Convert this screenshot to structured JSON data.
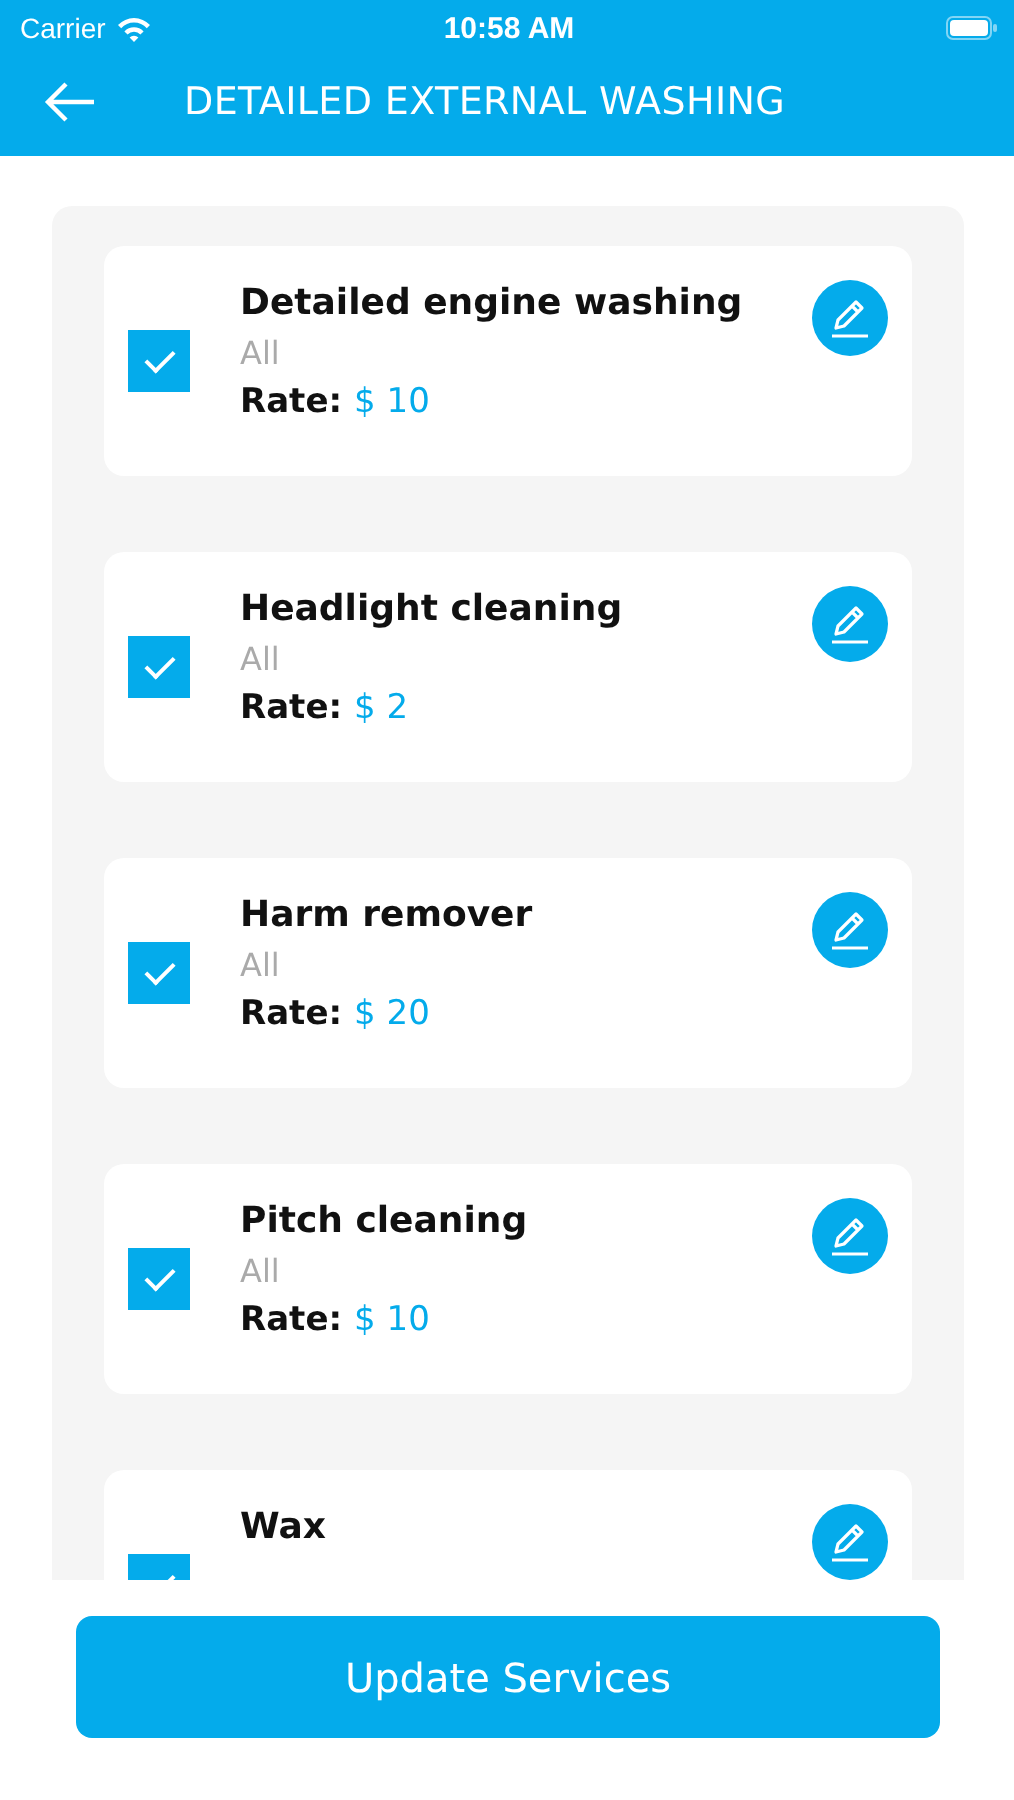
{
  "status_bar": {
    "carrier": "Carrier",
    "time": "10:58 AM"
  },
  "header": {
    "title": "DETAILED EXTERNAL WASHING"
  },
  "services": [
    {
      "name": "Detailed engine washing",
      "scope": "All",
      "rate_label": "Rate:",
      "rate": "$ 10",
      "checked": true
    },
    {
      "name": "Headlight cleaning",
      "scope": "All",
      "rate_label": "Rate:",
      "rate": "$ 2",
      "checked": true
    },
    {
      "name": "Harm remover",
      "scope": "All",
      "rate_label": "Rate:",
      "rate": "$ 20",
      "checked": true
    },
    {
      "name": "Pitch cleaning",
      "scope": "All",
      "rate_label": "Rate:",
      "rate": "$ 10",
      "checked": true
    },
    {
      "name": "Wax",
      "checked": true
    }
  ],
  "footer": {
    "button": "Update Services"
  }
}
